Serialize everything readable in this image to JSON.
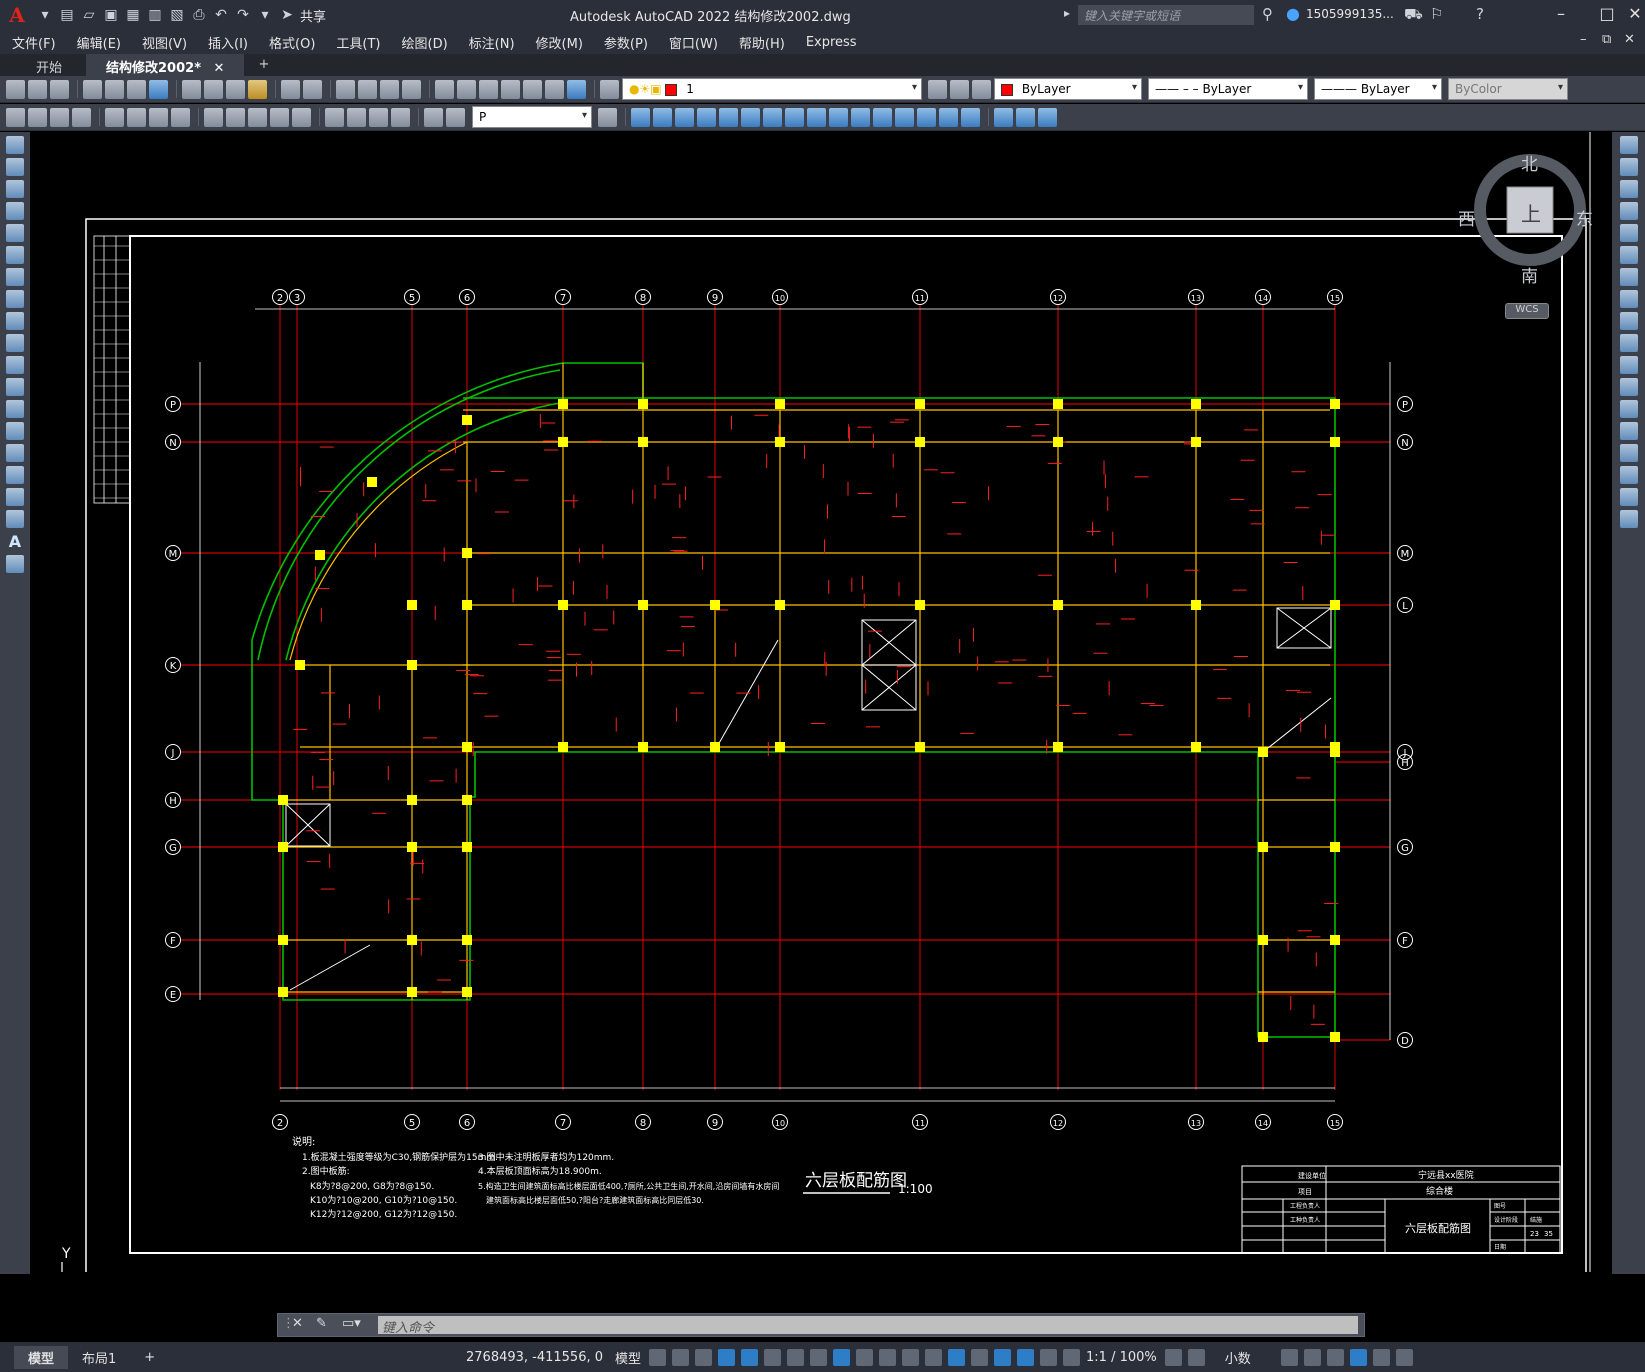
{
  "app": {
    "title": "Autodesk AutoCAD 2022    结构修改2002.dwg",
    "share_label": "共享",
    "search_placeholder": "键入关键字或短语",
    "user": "1505999135..."
  },
  "menu": [
    "文件(F)",
    "编辑(E)",
    "视图(V)",
    "插入(I)",
    "格式(O)",
    "工具(T)",
    "绘图(D)",
    "标注(N)",
    "修改(M)",
    "参数(P)",
    "窗口(W)",
    "帮助(H)",
    "Express"
  ],
  "tabs": [
    {
      "label": "开始"
    },
    {
      "label": "结构修改2002*"
    }
  ],
  "properties": {
    "layer": "1",
    "color": "ByLayer",
    "linetype": "ByLayer",
    "lineweight": "ByLayer",
    "plotstyle": "ByColor",
    "style": "P"
  },
  "viewcube": {
    "north": "北",
    "south": "南",
    "east": "东",
    "west": "西",
    "top": "上",
    "wcs": "WCS"
  },
  "drawing": {
    "title": "六层板配筋图",
    "scale": "1:100",
    "axes_top": [
      "2",
      "3",
      "5",
      "6",
      "7",
      "8",
      "9",
      "10",
      "11",
      "12",
      "13",
      "14",
      "15"
    ],
    "axes_bottom": [
      "2",
      "5",
      "6",
      "7",
      "8",
      "9",
      "10",
      "11",
      "12",
      "13",
      "14",
      "15"
    ],
    "axes_left": [
      "P",
      "N",
      "M",
      "K",
      "J",
      "H",
      "G",
      "F",
      "E"
    ],
    "axes_right": [
      "P",
      "N",
      "M",
      "L",
      "J",
      "H",
      "G",
      "F",
      "D"
    ],
    "notes_title": "说明:",
    "notes_left": [
      "1.板混凝土强度等级为C30,钢筋保护层为15mm.",
      "2.图中板筋:",
      "K8为?8@200,  G8为?8@150.",
      "K10为?10@200, G10为?10@150.",
      "K12为?12@200, G12为?12@150."
    ],
    "notes_right": [
      "3.图中未注明板厚者均为120mm.",
      "4.本层板顶面标高为18.900m.",
      "5.构造卫生间建筑面标高比楼层面低400,?厕所,公共卫生间,开水间,沿房间墙有水房间",
      "建筑面标高比楼层面低50,?阳台?走廊建筑面标高比同层低30."
    ],
    "titleblock": {
      "row1_a": "建设单位",
      "row1_b": "宁远县xx医院",
      "row2_a": "项目",
      "row2_b": "综合楼",
      "sheet_title": "六层板配筋图",
      "cells": [
        "工程负责人",
        "工种负责人",
        "图号",
        "设计阶段",
        "结施",
        "日期"
      ],
      "sheet_no": "23",
      "sheet_total": "35"
    }
  },
  "command": {
    "placeholder": "键入命令"
  },
  "layout_tabs": [
    "模型",
    "布局1"
  ],
  "status": {
    "coords": "2768493, -411556, 0",
    "space": "模型",
    "scale": "1:1 / 100%",
    "units": "小数"
  },
  "colors": {
    "accent": "#2f8ce0",
    "beam": "#ffc000",
    "grid": "#ff0000",
    "wall": "#00c000",
    "column": "#ffff00"
  }
}
